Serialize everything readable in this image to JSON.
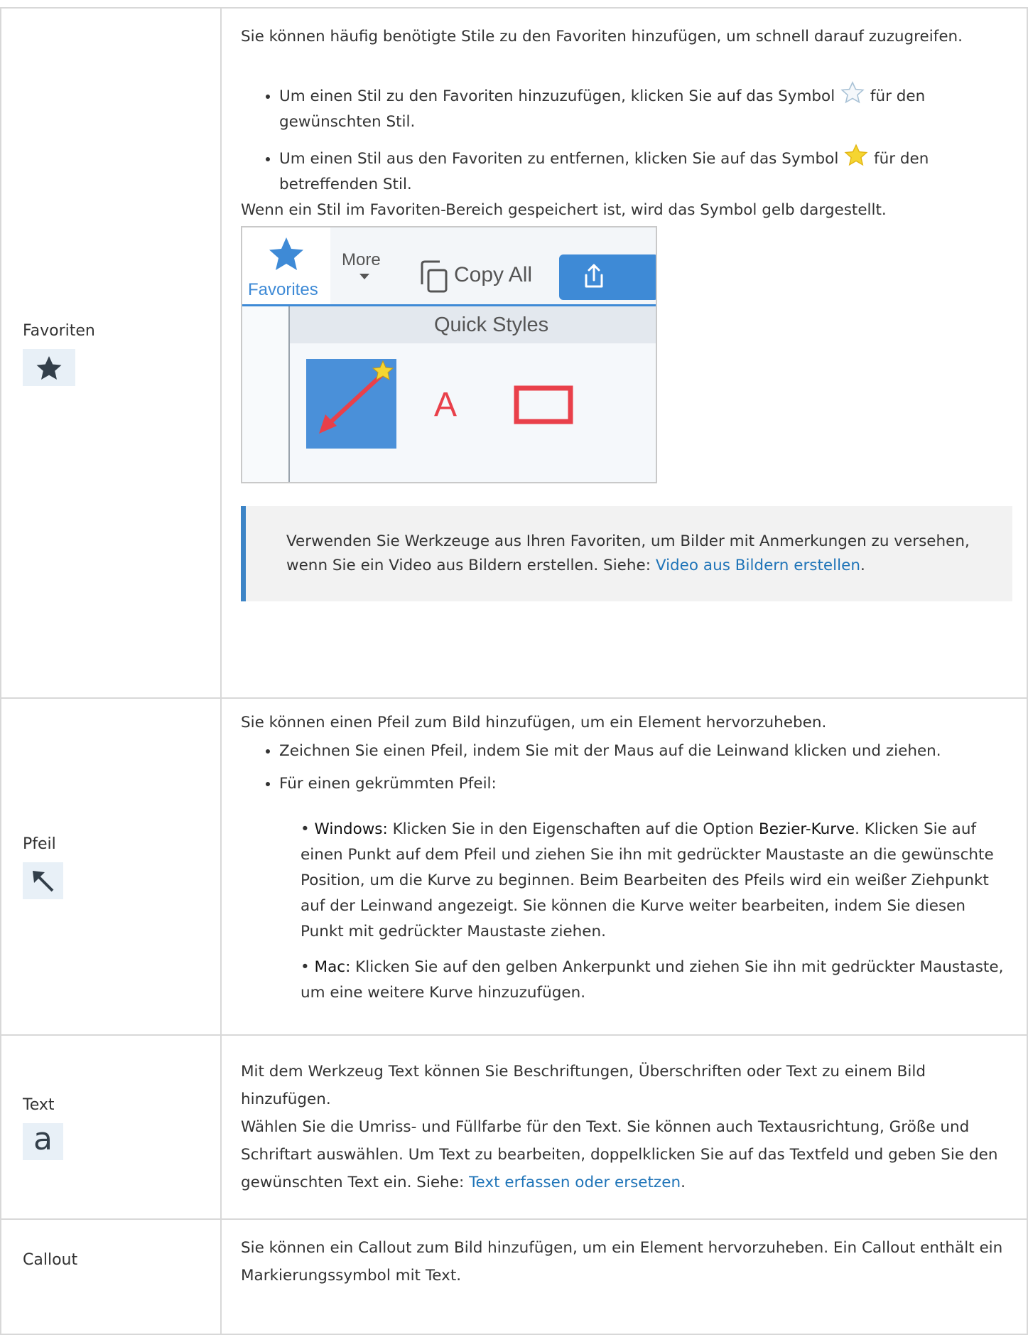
{
  "rows": {
    "favoriten": {
      "name": "Favoriten",
      "intro": "Sie können häufig benötigte Stile zu den Favoriten hinzufügen, um schnell darauf zuzugreifen.",
      "bullet1_before": "Um einen Stil zu den Favoriten hinzuzufügen, klicken Sie auf das Symbol",
      "bullet1_after": "für den gewünschten Stil.",
      "bullet2_before": "Um einen Stil aus den Favoriten zu entfernen, klicken Sie auf das Symbol",
      "bullet2_after": "für den betreffenden Stil.",
      "after_list": "Wenn ein Stil im Favoriten-Bereich gespeichert ist, wird das Symbol gelb dargestellt.",
      "screenshot": {
        "tab_favorites": "Favorites",
        "tab_more": "More",
        "copy_all": "Copy All",
        "quick_styles": "Quick Styles",
        "text_style_letter": "A"
      },
      "note_text": "Verwenden Sie Werkzeuge aus Ihren Favoriten, um Bilder mit Anmerkungen zu versehen, wenn Sie ein Video aus Bildern erstellen. Siehe: ",
      "note_link": "Video aus Bildern erstellen",
      "note_end": "."
    },
    "pfeil": {
      "name": "Pfeil",
      "intro": "Sie können einen Pfeil zum Bild hinzufügen, um ein Element hervorzuheben.",
      "bullet1": "Zeichnen Sie einen Pfeil, indem Sie mit der Maus auf die Leinwand klicken und ziehen.",
      "bullet2": "Für einen gekrümmten Pfeil:",
      "windows_label": "Windows:",
      "windows_text1": " Klicken Sie in den Eigenschaften auf die Option ",
      "windows_bold": "Bezier-Kurve",
      "windows_text2": ". Klicken Sie auf einen Punkt auf dem Pfeil und ziehen Sie ihn mit gedrückter Maustaste an die gewünschte Position, um die Kurve zu beginnen. Beim Bearbeiten des Pfeils wird ein weißer Ziehpunkt auf der Leinwand angezeigt. Sie können die Kurve weiter bearbeiten, indem Sie diesen Punkt mit gedrückter Maustaste ziehen.",
      "mac_label": "Mac:",
      "mac_text": " Klicken Sie auf den gelben Ankerpunkt und ziehen Sie ihn mit gedrückter Maustaste, um eine weitere Kurve hinzuzufügen."
    },
    "text": {
      "name": "Text",
      "icon_glyph": "a",
      "para1": "Mit dem Werkzeug Text können Sie Beschriftungen, Überschriften oder Text zu einem Bild hinzufügen.",
      "para2": "Wählen Sie die Umriss- und Füllfarbe für den Text. Sie können auch Textausrichtung, Größe und Schriftart auswählen. Um Text zu bearbeiten, doppelklicken Sie auf das Textfeld und geben Sie den gewünschten Text ein. Siehe: ",
      "link": "Text erfassen oder ersetzen",
      "end": "."
    },
    "callout": {
      "name": "Callout",
      "text": "Sie können ein Callout zum Bild hinzufügen, um ein Element hervorzuheben. Ein Callout enthält ein Markierungssymbol mit Text."
    }
  },
  "colors": {
    "link": "#1f74b8",
    "note_border": "#3d84c6",
    "star_yellow": "#f5d531",
    "icon_bg": "#e8f0f7",
    "ui_blue": "#4a90d9"
  }
}
